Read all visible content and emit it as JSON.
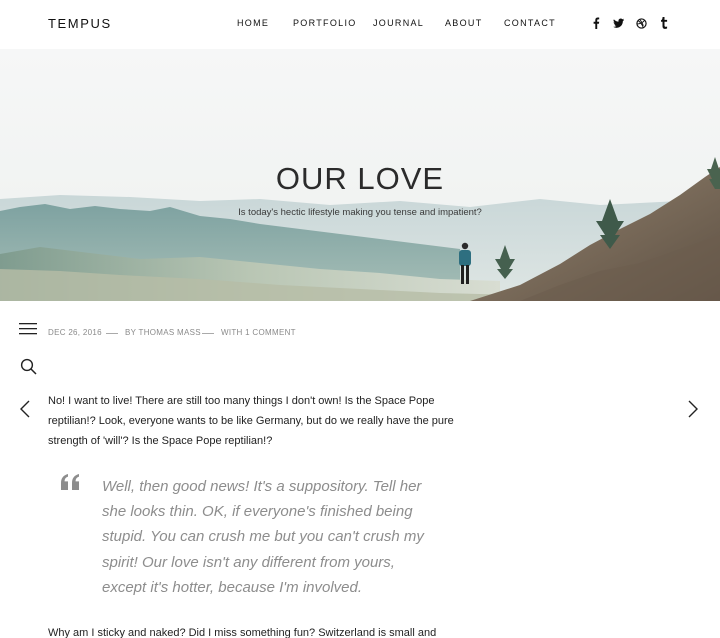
{
  "header": {
    "logo": "TEMPUS",
    "nav": [
      {
        "label": "HOME"
      },
      {
        "label": "PORTFOLIO"
      },
      {
        "label": "JOURNAL"
      },
      {
        "label": "ABOUT"
      },
      {
        "label": "CONTACT"
      }
    ],
    "social": [
      {
        "icon": "facebook-icon",
        "glyph": "f"
      },
      {
        "icon": "twitter-icon",
        "glyph": "twitter"
      },
      {
        "icon": "dribbble-icon",
        "glyph": "dribbble"
      },
      {
        "icon": "tumblr-icon",
        "glyph": "t"
      }
    ]
  },
  "hero": {
    "title": "OUR LOVE",
    "subtitle": "Is today's hectic lifestyle making you tense and impatient?"
  },
  "post": {
    "meta": {
      "date": "DEC 26, 2016",
      "author": "BY THOMAS MASS",
      "comments": "WITH 1 COMMENT"
    },
    "paragraph1": "No! I want to live! There are still too many things I don't own! Is the Space Pope reptilian!? Look, everyone wants to be like Germany, but do we really have the pure strength of 'will'? Is the Space Pope reptilian!?",
    "quote": "Well, then good news! It's a suppository. Tell her she looks thin. OK, if everyone's finished being stupid. You can crush me but you can't crush my spirit! Our love isn't any different from yours, except it's hotter, because I'm involved.",
    "paragraph2": "Why am I sticky and naked? Did I miss something fun? Switzerland is small and"
  },
  "tools": {
    "menu": "hamburger-menu-icon",
    "search": "search-icon",
    "prev": "chevron-left-icon",
    "next": "chevron-right-icon"
  },
  "colors": {
    "text": "#222222",
    "muted": "#8a8a8a",
    "quote": "#8d8d8d",
    "sky": "#f3f5f6"
  }
}
